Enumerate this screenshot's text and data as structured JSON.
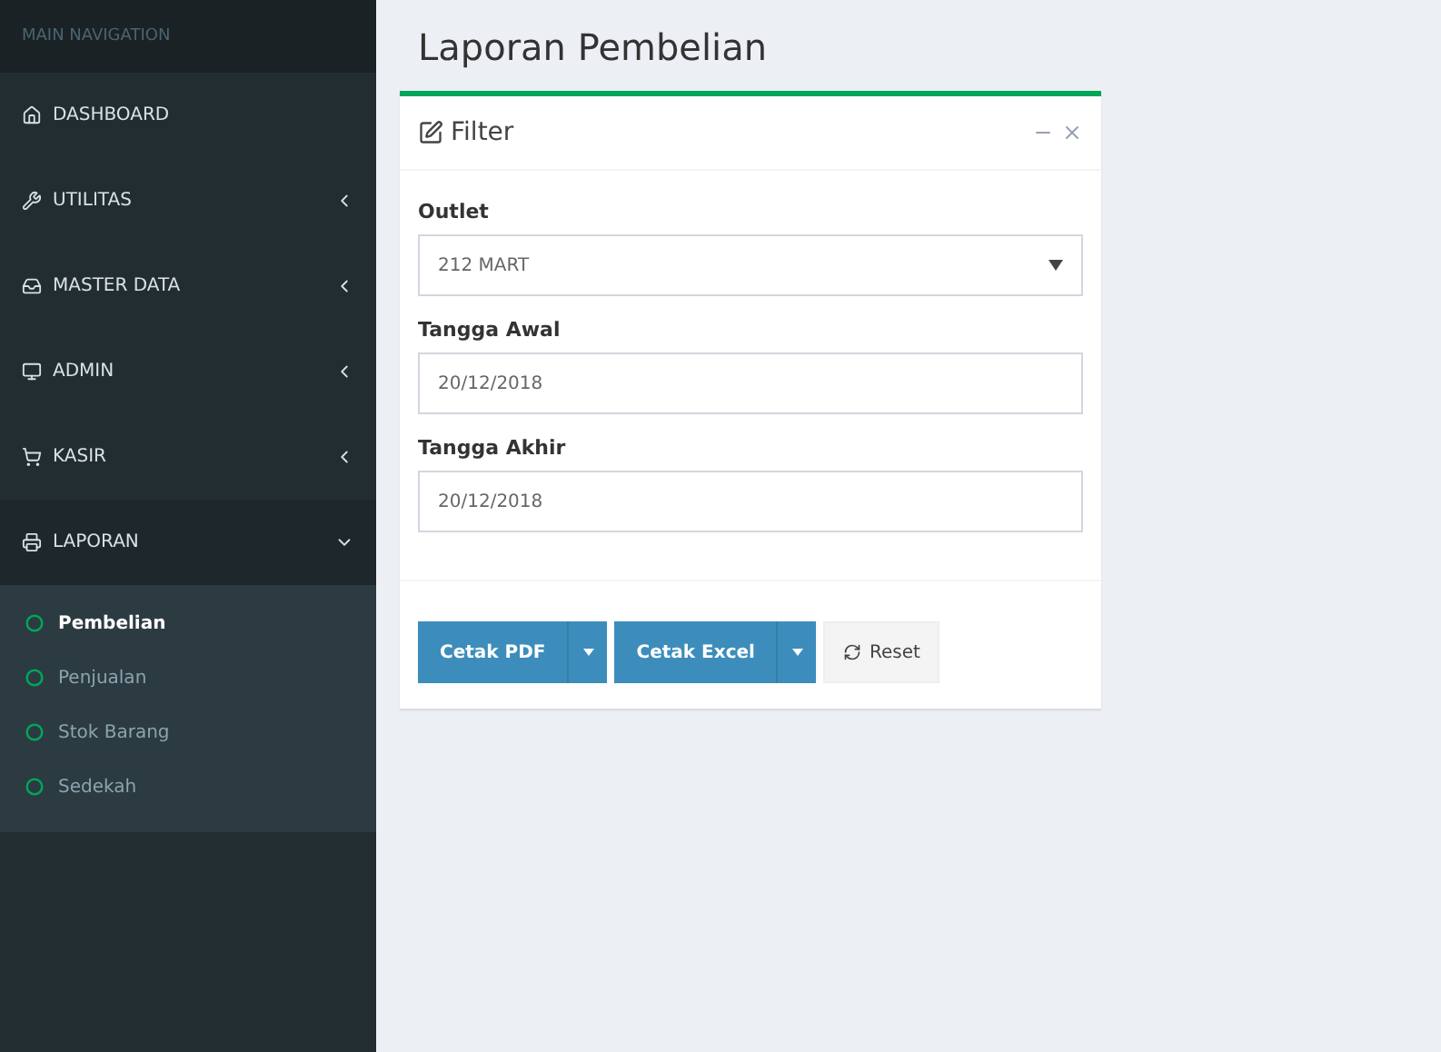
{
  "sidebar": {
    "header": "MAIN NAVIGATION",
    "items": [
      {
        "label": "DASHBOARD"
      },
      {
        "label": "UTILITAS",
        "expanded": false
      },
      {
        "label": "MASTER DATA",
        "expanded": false
      },
      {
        "label": "ADMIN",
        "expanded": false
      },
      {
        "label": "KASIR",
        "expanded": false
      },
      {
        "label": "LAPORAN",
        "expanded": true,
        "children": [
          {
            "label": "Pembelian",
            "selected": true
          },
          {
            "label": "Penjualan",
            "selected": false
          },
          {
            "label": "Stok Barang",
            "selected": false
          },
          {
            "label": "Sedekah",
            "selected": false
          }
        ]
      }
    ]
  },
  "page_title": "Laporan Pembelian",
  "filter_box": {
    "title": "Filter",
    "fields": [
      {
        "kind": "select",
        "label": "Outlet",
        "value": "212 MART"
      },
      {
        "kind": "text",
        "label": "Tangga Awal",
        "value": "20/12/2018"
      },
      {
        "kind": "text",
        "label": "Tangga Akhir",
        "value": "20/12/2018"
      }
    ],
    "buttons": [
      {
        "kind": "split",
        "label": "Cetak PDF"
      },
      {
        "kind": "split",
        "label": "Cetak Excel"
      },
      {
        "kind": "reset",
        "label": "Reset"
      }
    ]
  }
}
